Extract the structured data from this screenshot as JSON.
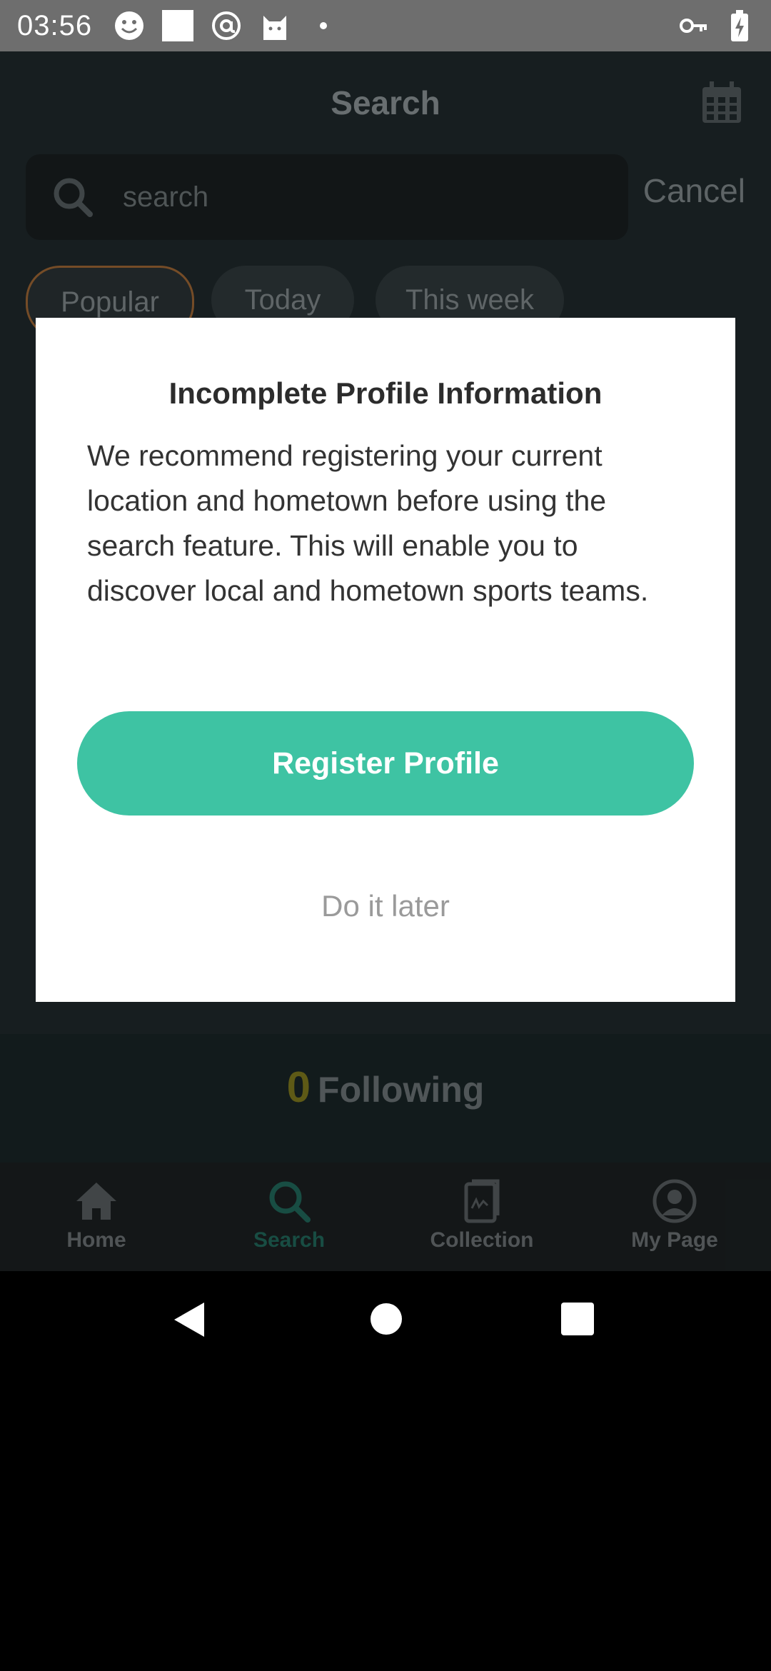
{
  "status_bar": {
    "time": "03:56",
    "icons_left": [
      "smiley-icon",
      "square-icon",
      "at-icon",
      "cat-icon",
      "dot-icon"
    ],
    "icons_right": [
      "key-icon",
      "battery-charging-icon"
    ]
  },
  "header": {
    "title": "Search"
  },
  "search": {
    "placeholder": "search",
    "cancel_label": "Cancel"
  },
  "filters": [
    {
      "label": "Popular",
      "active": true
    },
    {
      "label": "Today",
      "active": false
    },
    {
      "label": "This week",
      "active": false
    }
  ],
  "following": {
    "count": "0",
    "label": "Following"
  },
  "bottom_nav": [
    {
      "label": "Home",
      "icon": "home-icon"
    },
    {
      "label": "Search",
      "icon": "search-icon",
      "active": true
    },
    {
      "label": "Collection",
      "icon": "collection-icon"
    },
    {
      "label": "My Page",
      "icon": "user-icon"
    }
  ],
  "dialog": {
    "title": "Incomplete Profile Information",
    "body": "We recommend registering your current location and hometown before using the search feature. This will enable you to discover local and hometown sports teams.",
    "primary_label": "Register Profile",
    "secondary_label": "Do it later"
  },
  "colors": {
    "accent": "#3ec3a3",
    "dim_background": "#1c2426"
  }
}
